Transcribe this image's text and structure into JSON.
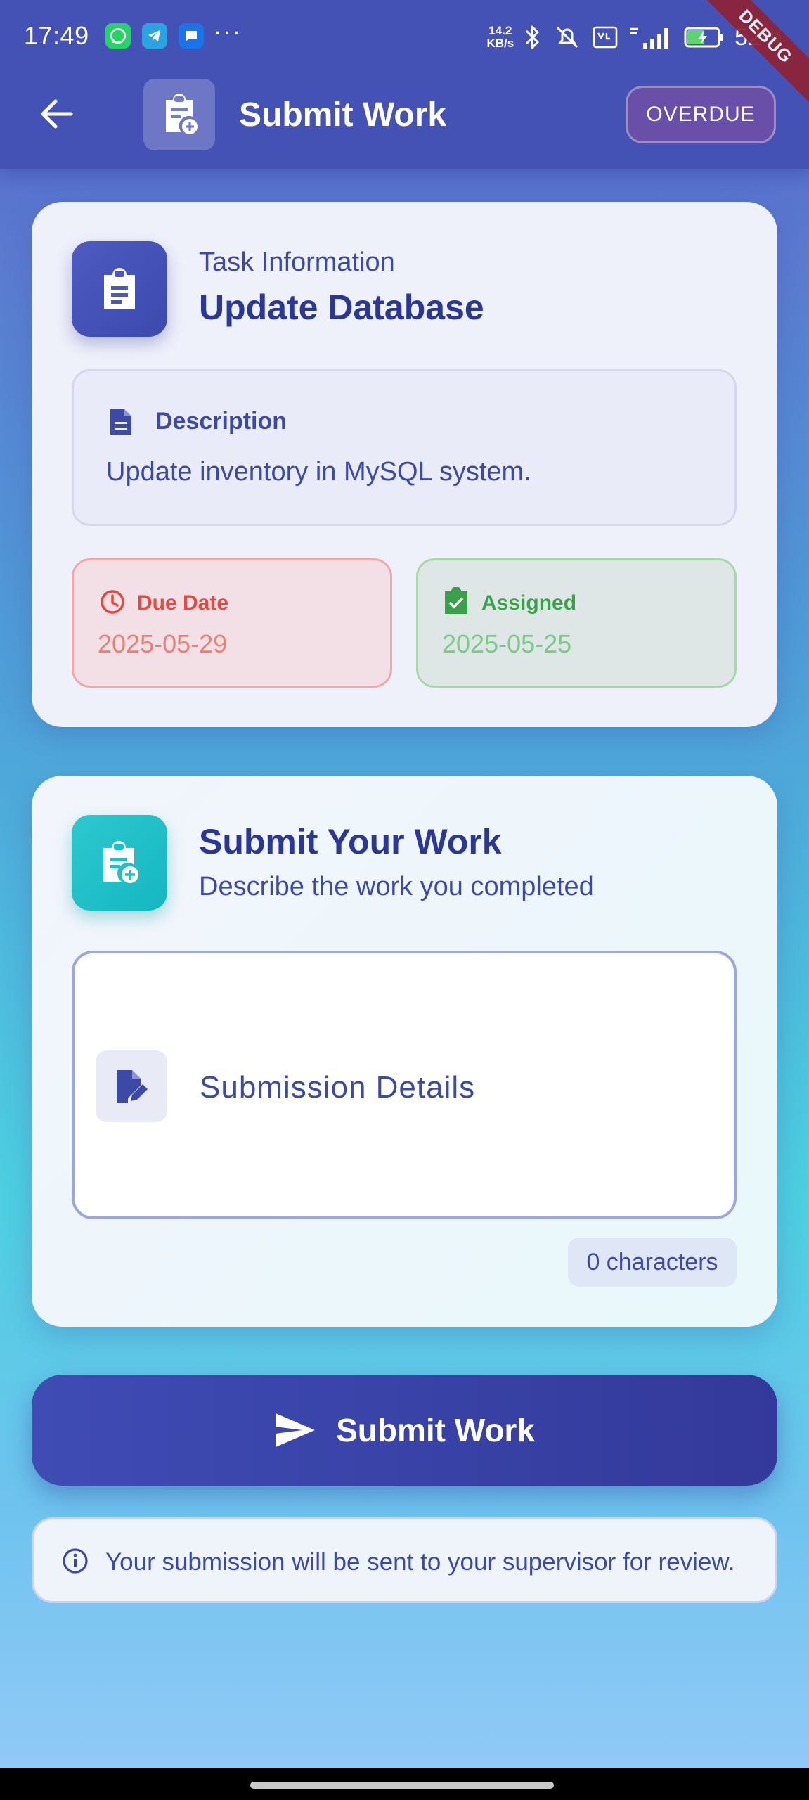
{
  "status_bar": {
    "time": "17:49",
    "more_indicator": "···",
    "net_speed_value": "14.2",
    "net_speed_unit": "KB/s",
    "battery_text": "52",
    "notification_icons": [
      "whatsapp-icon",
      "telegram-icon",
      "messages-icon"
    ]
  },
  "debug_banner": "DEBUG",
  "header": {
    "title": "Submit Work",
    "badge": "OVERDUE"
  },
  "task_card": {
    "section_label": "Task Information",
    "title": "Update Database",
    "description_label": "Description",
    "description": "Update inventory in MySQL system.",
    "due_label": "Due Date",
    "due_value": "2025-05-29",
    "assigned_label": "Assigned",
    "assigned_value": "2025-05-25"
  },
  "submit_card": {
    "heading": "Submit Your Work",
    "subheading": "Describe the work you completed",
    "details_placeholder": "Submission Details",
    "char_count": "0 characters"
  },
  "submit_button": {
    "label": "Submit Work"
  },
  "info_banner": {
    "text": "Your submission will be sent to your supervisor for review."
  },
  "colors": {
    "primary": "#4451b5",
    "accent_teal": "#1fbfc8",
    "due_red": "#e3493f",
    "assigned_green": "#3aa14a",
    "overdue_badge": "#6a4fa8"
  }
}
